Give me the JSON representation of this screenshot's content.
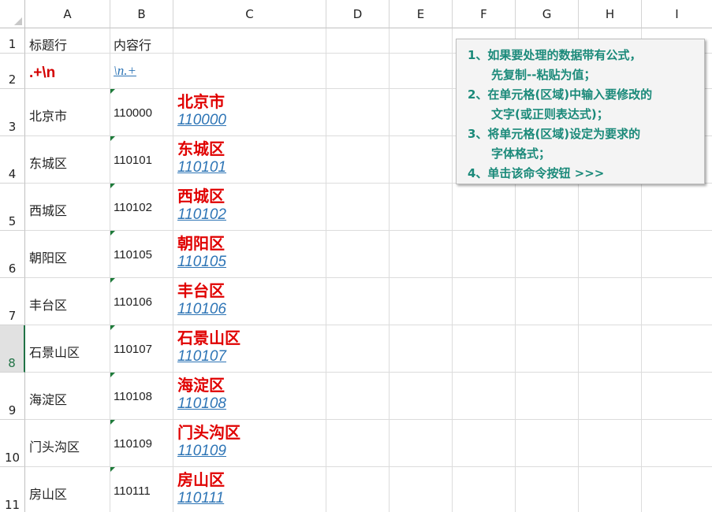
{
  "columns": [
    "A",
    "B",
    "C",
    "D",
    "E",
    "F",
    "G",
    "H",
    "I"
  ],
  "rows": [
    "1",
    "2",
    "3",
    "4",
    "5",
    "6",
    "7",
    "8",
    "9",
    "10",
    "11"
  ],
  "header_row": {
    "a": "标题行",
    "b": "内容行"
  },
  "regex_row": {
    "a": ".+\\n",
    "b": "\\n.+"
  },
  "data_rows": [
    {
      "name": "北京市",
      "code": "110000"
    },
    {
      "name": "东城区",
      "code": "110101"
    },
    {
      "name": "西城区",
      "code": "110102"
    },
    {
      "name": "朝阳区",
      "code": "110105"
    },
    {
      "name": "丰台区",
      "code": "110106"
    },
    {
      "name": "石景山区",
      "code": "110107"
    },
    {
      "name": "海淀区",
      "code": "110108"
    },
    {
      "name": "门头沟区",
      "code": "110109"
    },
    {
      "name": "房山区",
      "code": "110111"
    }
  ],
  "note": {
    "lines": [
      "1、如果要处理的数据带有公式，",
      "先复制--粘贴为值；",
      "2、在单元格(区域)中输入要修改的",
      "文字(或正则表达式)；",
      "3、将单元格(区域)设定为要求的",
      "字体格式；",
      "4、单击该命令按钮 >>>"
    ]
  },
  "colors": {
    "accent": "#217346",
    "red": "#e00000",
    "blue": "#2e75b6",
    "note_text": "#1b8a7a"
  }
}
